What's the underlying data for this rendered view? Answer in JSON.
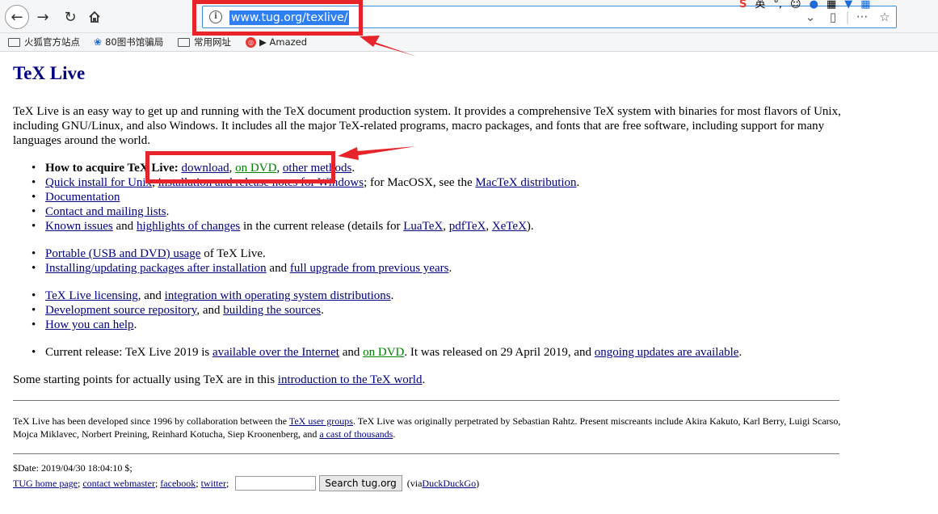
{
  "browser": {
    "url": "www.tug.org/texlive/",
    "ext_sogou": "S",
    "ext_lang": "英",
    "bookmarks": [
      {
        "label": "火狐官方站点"
      },
      {
        "label": "80图书馆骗局"
      },
      {
        "label": "常用网址"
      },
      {
        "label": "▶ Amazed"
      }
    ]
  },
  "page": {
    "title": "TeX Live",
    "intro": "TeX Live is an easy way to get up and running with the TeX document production system. It provides a comprehensive TeX system with binaries for most flavors of Unix, including GNU/Linux, and also Windows. It includes all the major TeX-related programs, macro packages, and fonts that are free software, including support for many languages around the world.",
    "acquire": {
      "label": "How to acquire TeX Live:",
      "download": "download",
      "dvd": "on DVD",
      "other": "other methods"
    },
    "quick": {
      "unix": "Quick install for Unix",
      "windows": "installation and release notes for Windows",
      "mid": "; for MacOSX, see the ",
      "mactex": "MacTeX distribution"
    },
    "documentation": "Documentation",
    "contact": "Contact and mailing lists",
    "known": {
      "issues": "Known issues",
      "and": " and ",
      "highlights": "highlights of changes",
      "mid": " in the current release (details for ",
      "luatex": "LuaTeX",
      "pdftex": "pdfTeX",
      "xetex": "XeTeX",
      "end": ")."
    },
    "portable": {
      "link": "Portable (USB and DVD) usage",
      "rest": " of TeX Live."
    },
    "installing": {
      "link": "Installing/updating packages after installation",
      "and": " and ",
      "upgrade": "full upgrade from previous years"
    },
    "licensing": {
      "link": "TeX Live licensing",
      "and": ", and ",
      "integration": "integration with operating system distributions"
    },
    "devsource": {
      "link": "Development source repository",
      "and": ", and ",
      "building": "building the sources"
    },
    "help": "How you can help",
    "current": {
      "pre": "Current release: TeX Live 2019 is ",
      "internet": "available over the Internet",
      "and": " and ",
      "dvd": "on DVD",
      "mid": ". It was released on 29 April 2019, and ",
      "updates": "ongoing updates are available"
    },
    "start": {
      "pre": "Some starting points for actually using TeX are in this ",
      "link": "introduction to the TeX world"
    },
    "footer": {
      "t1": "TeX Live has been developed since 1996 by collaboration between the ",
      "usergroups": "TeX user groups",
      "t2": ". TeX Live was originally perpetrated by Sebastian Rahtz. Present miscreants include Akira Kakuto, Karl Berry, Luigi Scarso, Mojca Miklavec, Norbert Preining, Reinhard Kotucha, Siep Kroonenberg, and ",
      "thousands": "a cast of thousands"
    },
    "date": "$Date: 2019/04/30 18:04:10 $;",
    "links": {
      "home": "TUG home page",
      "webmaster": "contact webmaster",
      "facebook": "facebook",
      "twitter": "twitter",
      "search_btn": "Search tug.org",
      "via": "(via ",
      "ddg": "DuckDuckGo"
    }
  }
}
